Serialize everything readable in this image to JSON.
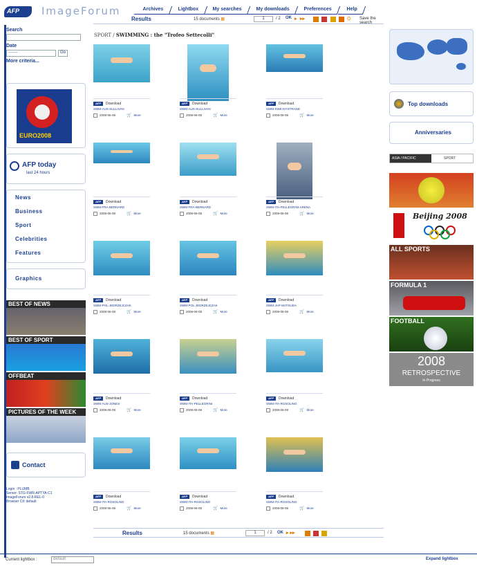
{
  "header": {
    "logo": "AFP",
    "brand": "ImageForum",
    "nav": [
      "Archives",
      "Lightbox",
      "My searches",
      "My downloads",
      "Preferences",
      "Help"
    ]
  },
  "results": {
    "label": "Results",
    "count": "15 documents",
    "page": "1",
    "page_of": "/ 2",
    "ok": "OK",
    "save_search": "Save the search"
  },
  "sidebar": {
    "search_label": "Search",
    "date_label": "Date",
    "date_select": "--------",
    "go": "Go",
    "more_criteria": "More criteria...",
    "euro_logo": "EURO2008",
    "afp_today": "AFP today",
    "afp_today_sub": "last 24 hours",
    "nav": [
      "News",
      "Business",
      "Sport",
      "Celebrities",
      "Features"
    ],
    "graphics": "Graphics",
    "banners": [
      "BEST OF NEWS",
      "BEST OF SPORT",
      "OFFBEAT",
      "PICTURES OF THE WEEK"
    ],
    "contact": "Contact",
    "info": [
      "Login : PLUMB",
      "Server: STG-FWR-APTYA-C1",
      "ImageForum v2.8-REL-0",
      "Browser Ctl: default"
    ]
  },
  "breadcrumb": {
    "section": "SPORT / ",
    "subject": "SWIMMING : the \"Trofeo Settecolli\""
  },
  "items": [
    {
      "ref": "SWM-AUS-SULLIVAN",
      "date": "2008-06-08"
    },
    {
      "ref": "SWM-AUS-SULLIVAN",
      "date": "2008-06-08"
    },
    {
      "ref": "SWM-SWE-NYSTRAND",
      "date": "2008-06-08"
    },
    {
      "ref": "SWM-FRA-BERNARD",
      "date": "2008-06-08"
    },
    {
      "ref": "SWM-FRA-BERNARD",
      "date": "2008-06-08"
    },
    {
      "ref": "SWM-ITA-PELLEGRINI-ARENA",
      "date": "2008-06-08"
    },
    {
      "ref": "SWM-POL-JEDRZEJCZAK",
      "date": "2008-06-08"
    },
    {
      "ref": "SWM-POL-JEDRZEJCZAK",
      "date": "2008-06-08"
    },
    {
      "ref": "SWM-JAP-MATSUDA",
      "date": "2008-06-08"
    },
    {
      "ref": "SWM-AUS-JONES",
      "date": "2008-06-08"
    },
    {
      "ref": "SWM-ITA-PELLEGRINI",
      "date": "2008-06-08"
    },
    {
      "ref": "SWM-ITA-ROSOLINO",
      "date": "2008-06-08"
    },
    {
      "ref": "SWM-ITA-ROSOLINO",
      "date": "2008-06-08"
    },
    {
      "ref": "SWM-ITA-ROSOLINO",
      "date": "2008-06-08"
    },
    {
      "ref": "SWM-ITA-ROSOLINO",
      "date": "2008-06-08"
    }
  ],
  "item_common": {
    "afp": "AFP",
    "download": "Download",
    "more": "More"
  },
  "right": {
    "top_downloads": "Top downloads",
    "anniversaries": "Anniversaries",
    "tab_asia": "ASIA / PACIFIC",
    "tab_sport": "SPORT",
    "beijing": "Beijing 2008",
    "all_sports": "ALL SPORTS",
    "formula1": "FORMULA 1",
    "football": "FOOTBALL",
    "retro_year": "2008",
    "retro_title": "RETROSPECTIVE",
    "retro_sub": "In Progress"
  },
  "footer": {
    "current_lightbox": "Current lightbox :",
    "lightbox_value": "default",
    "expand": "Expand lightbox"
  }
}
